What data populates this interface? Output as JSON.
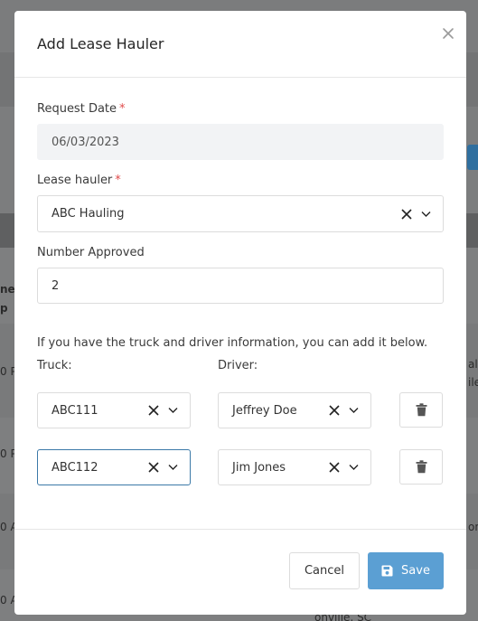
{
  "background": {
    "fragments": [
      "ne",
      "p",
      "0 P",
      "0 P",
      "0 A",
      "0 A",
      "0 A",
      "al-",
      "ile",
      "on",
      "onville, SC"
    ]
  },
  "modal": {
    "title": "Add Lease Hauler",
    "close_label": "×",
    "request_date": {
      "label": "Request Date",
      "required": "*",
      "value": "06/03/2023"
    },
    "lease_hauler": {
      "label": "Lease hauler",
      "required": "*",
      "value": "ABC Hauling"
    },
    "number_approved": {
      "label": "Number Approved",
      "value": "2"
    },
    "hint": "If you have the truck and driver information, you can add it below.",
    "truck_label": "Truck:",
    "driver_label": "Driver:",
    "rows": [
      {
        "truck": "ABC111",
        "driver": "Jeffrey Doe"
      },
      {
        "truck": "ABC112",
        "driver": "Jim Jones"
      }
    ],
    "cancel_label": "Cancel",
    "save_label": "Save"
  },
  "colors": {
    "accent": "#5b9fd3",
    "required": "#e04b4b",
    "focus_border": "#3b79a8"
  }
}
